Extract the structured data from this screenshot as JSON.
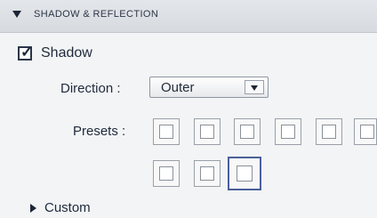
{
  "section": {
    "title": "SHADOW & REFLECTION",
    "expanded_icon": "triangle-down-icon"
  },
  "shadow": {
    "checkbox_label": "Shadow",
    "checked": true,
    "check_glyph": "✓"
  },
  "direction": {
    "label": "Direction :",
    "value": "Outer",
    "options_visible": [
      "Outer"
    ]
  },
  "presets": {
    "label": "Presets :",
    "items": [
      {
        "name": "preset-1",
        "selected": false
      },
      {
        "name": "preset-2",
        "selected": false
      },
      {
        "name": "preset-3",
        "selected": false
      },
      {
        "name": "preset-4",
        "selected": false
      },
      {
        "name": "preset-5",
        "selected": false
      },
      {
        "name": "preset-6",
        "selected": false
      },
      {
        "name": "preset-7",
        "selected": false
      },
      {
        "name": "preset-8",
        "selected": false
      },
      {
        "name": "preset-9",
        "selected": true
      }
    ]
  },
  "custom": {
    "label": "Custom",
    "collapsed_icon": "triangle-right-icon"
  },
  "colors": {
    "panel_bg": "#f2f4f6",
    "header_bg": "#dcdfe3",
    "selected_border": "#4a5f9a"
  }
}
